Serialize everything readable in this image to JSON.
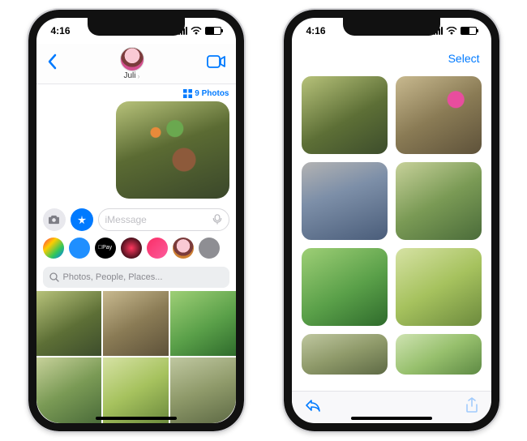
{
  "status": {
    "time": "4:16",
    "am": "🕗"
  },
  "left": {
    "contact_name": "Juli",
    "photo_count_label": "9 Photos",
    "message_placeholder": "iMessage",
    "search_placeholder": "Photos, People, Places...",
    "apps": [
      {
        "name": "photos-app",
        "bg": "linear-gradient(135deg,#ff2d55,#ffcc00,#34c759,#007aff)"
      },
      {
        "name": "appstore-app",
        "bg": "#1f8fff"
      },
      {
        "name": "applepay-app",
        "bg": "#000",
        "label": "Pay"
      },
      {
        "name": "fitness-app",
        "bg": "radial-gradient(circle,#ff375f,#000)"
      },
      {
        "name": "music-app",
        "bg": "linear-gradient(135deg,#fa2e66,#fc5c9c)"
      },
      {
        "name": "memoji-app",
        "bg": "radial-gradient(circle at 50% 40%,#f9c9d4 0 40%,#7b3b3b 41% 60%,#cd7f32 61% 100%)"
      },
      {
        "name": "more-app",
        "bg": "#8e8e93"
      }
    ],
    "mini_grid": [
      "p1",
      "p2",
      "p5",
      "p4",
      "p6",
      "p7"
    ]
  },
  "right": {
    "select_label": "Select",
    "grid": [
      {
        "cls": "p1"
      },
      {
        "cls": "ppink"
      },
      {
        "cls": "p3"
      },
      {
        "cls": "p4"
      },
      {
        "cls": "p5"
      },
      {
        "cls": "p6"
      },
      {
        "cls": "p7 short"
      },
      {
        "cls": "p8 short"
      }
    ]
  }
}
